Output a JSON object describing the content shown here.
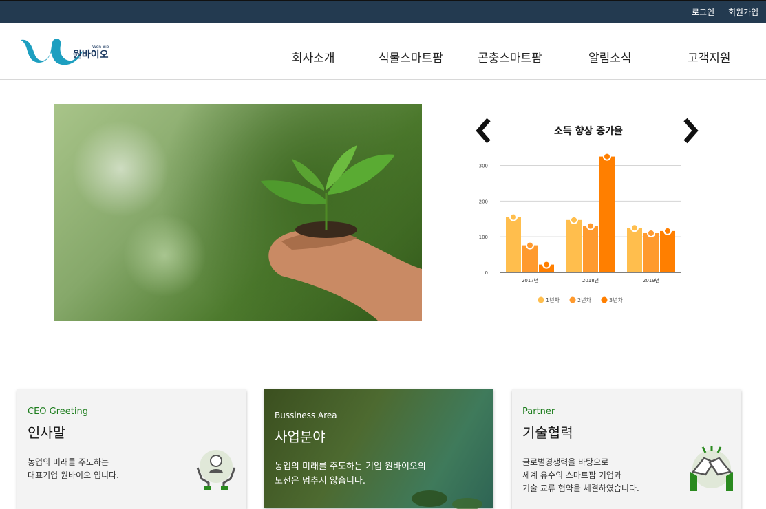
{
  "top_links": {
    "login": "로그인",
    "signup": "회원가입"
  },
  "logo": {
    "small_text": "Won Bio",
    "text": "원바이오"
  },
  "nav": [
    "회사소개",
    "식물스마트팜",
    "곤충스마트팜",
    "알림소식",
    "고객지원"
  ],
  "chart_data": {
    "type": "bar",
    "title": "소득 향상 증가율",
    "categories": [
      "2017년",
      "2018년",
      "2019년"
    ],
    "series": [
      {
        "name": "1년차",
        "values": [
          155,
          147,
          125
        ],
        "color": "#ffbe4d"
      },
      {
        "name": "2년차",
        "values": [
          76,
          130,
          110
        ],
        "color": "#ff9a2e"
      },
      {
        "name": "3년차",
        "values": [
          22,
          325,
          116
        ],
        "color": "#ff7f00"
      }
    ],
    "ylim": [
      0,
      330
    ],
    "yticks": [
      "0",
      "100",
      "200",
      "300"
    ],
    "grid": true,
    "legend": "bottom"
  },
  "cards": [
    {
      "eng": "CEO Greeting",
      "kor": "인사말",
      "desc": "농업의 미래를 주도하는\n대표기업 원바이오 입니다.",
      "icon": "ceo-hands-icon"
    },
    {
      "eng": "Bussiness Area",
      "kor": "사업분야",
      "desc": "농업의 미래를 주도하는 기업 원바이오의\n도전은 멈추지 않습니다.",
      "icon": ""
    },
    {
      "eng": "Partner",
      "kor": "기술협력",
      "desc": "글로벌경쟁력을 바탕으로\n세계 유수의 스마트팜 기업과\n기술 교류 협약을 체결하였습니다.",
      "icon": "handshake-icon"
    }
  ]
}
